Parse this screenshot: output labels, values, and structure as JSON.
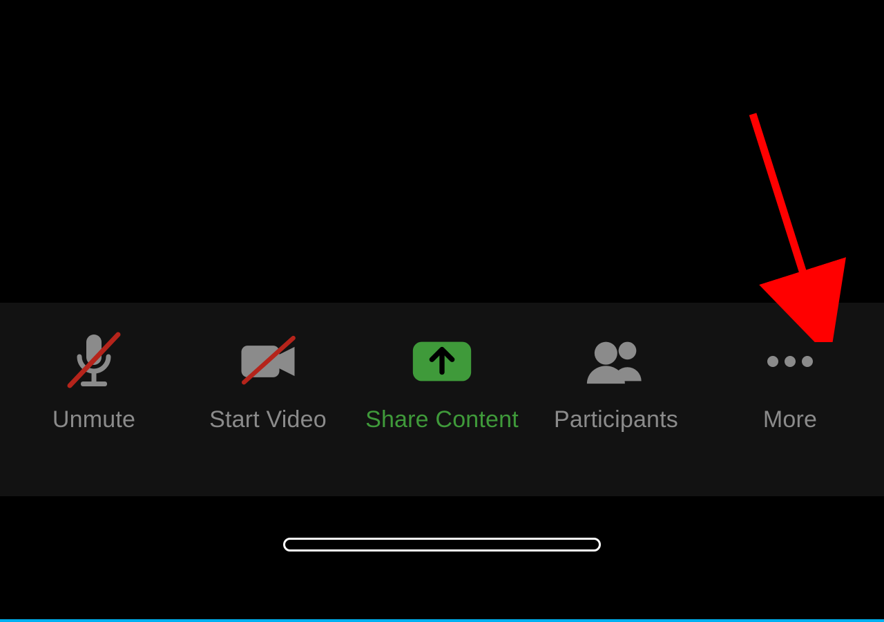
{
  "toolbar": {
    "unmute": {
      "label": "Unmute"
    },
    "start_video": {
      "label": "Start Video"
    },
    "share_content": {
      "label": "Share Content"
    },
    "participants": {
      "label": "Participants"
    },
    "more": {
      "label": "More"
    }
  },
  "colors": {
    "share_green": "#3f9a3a",
    "icon_gray": "#8b8b8b",
    "slash_red": "#b5241b",
    "arrow_red": "#ff0000"
  }
}
